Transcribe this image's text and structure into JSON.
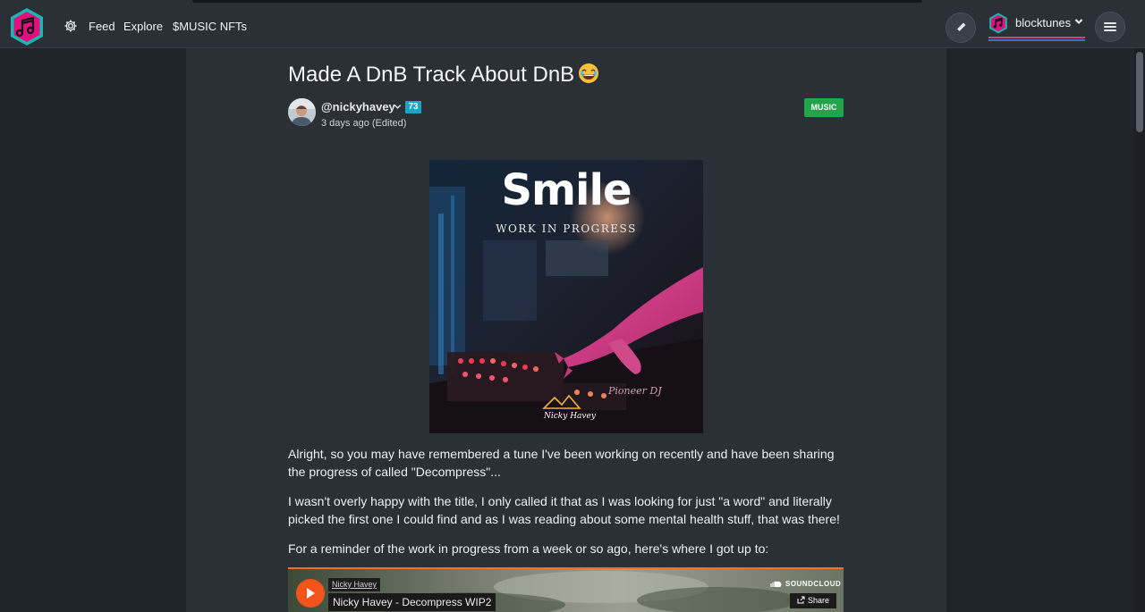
{
  "nav": {
    "links": [
      "Feed",
      "Explore",
      "$MUSIC NFTs"
    ],
    "user": "blocktunes",
    "icons": [
      "blocktunes-logo-icon",
      "gear-icon",
      "pencil-icon",
      "hamburger-icon",
      "chevron-down-icon"
    ]
  },
  "post": {
    "title": "Made A DnB Track About DnB",
    "author": "@nickyhavey",
    "reputation": "73",
    "time": "3 days ago",
    "edited": "(Edited)",
    "tag": "MUSIC",
    "cover": {
      "title": "Smile",
      "subtitle": "WORK IN PROGRESS",
      "signature": "Nicky Havey"
    },
    "paragraphs": [
      "Alright, so you may have remembered a tune I've been working on recently and have been sharing the progress of called \"Decompress\"...",
      "I wasn't overly happy with the title, I only called it that as I was looking for just \"a word\" and literally picked the first one I could find and as I was reading about some mental health stuff, that was there!",
      "For a reminder of the work in progress from a week or so ago, here's where I got up to:"
    ]
  },
  "embed": {
    "artist": "Nicky Havey",
    "track": "Nicky Havey - Decompress WIP2",
    "brand": "SOUNDCLOUD",
    "share": "Share",
    "accent": "#f26f23"
  },
  "colors": {
    "page_bg": "#1f232a",
    "panel_bg": "#2b2f36",
    "brand_pink": "#e0107f",
    "reputation_badge": "#1aa3c8",
    "tag_green": "#21a44a"
  }
}
